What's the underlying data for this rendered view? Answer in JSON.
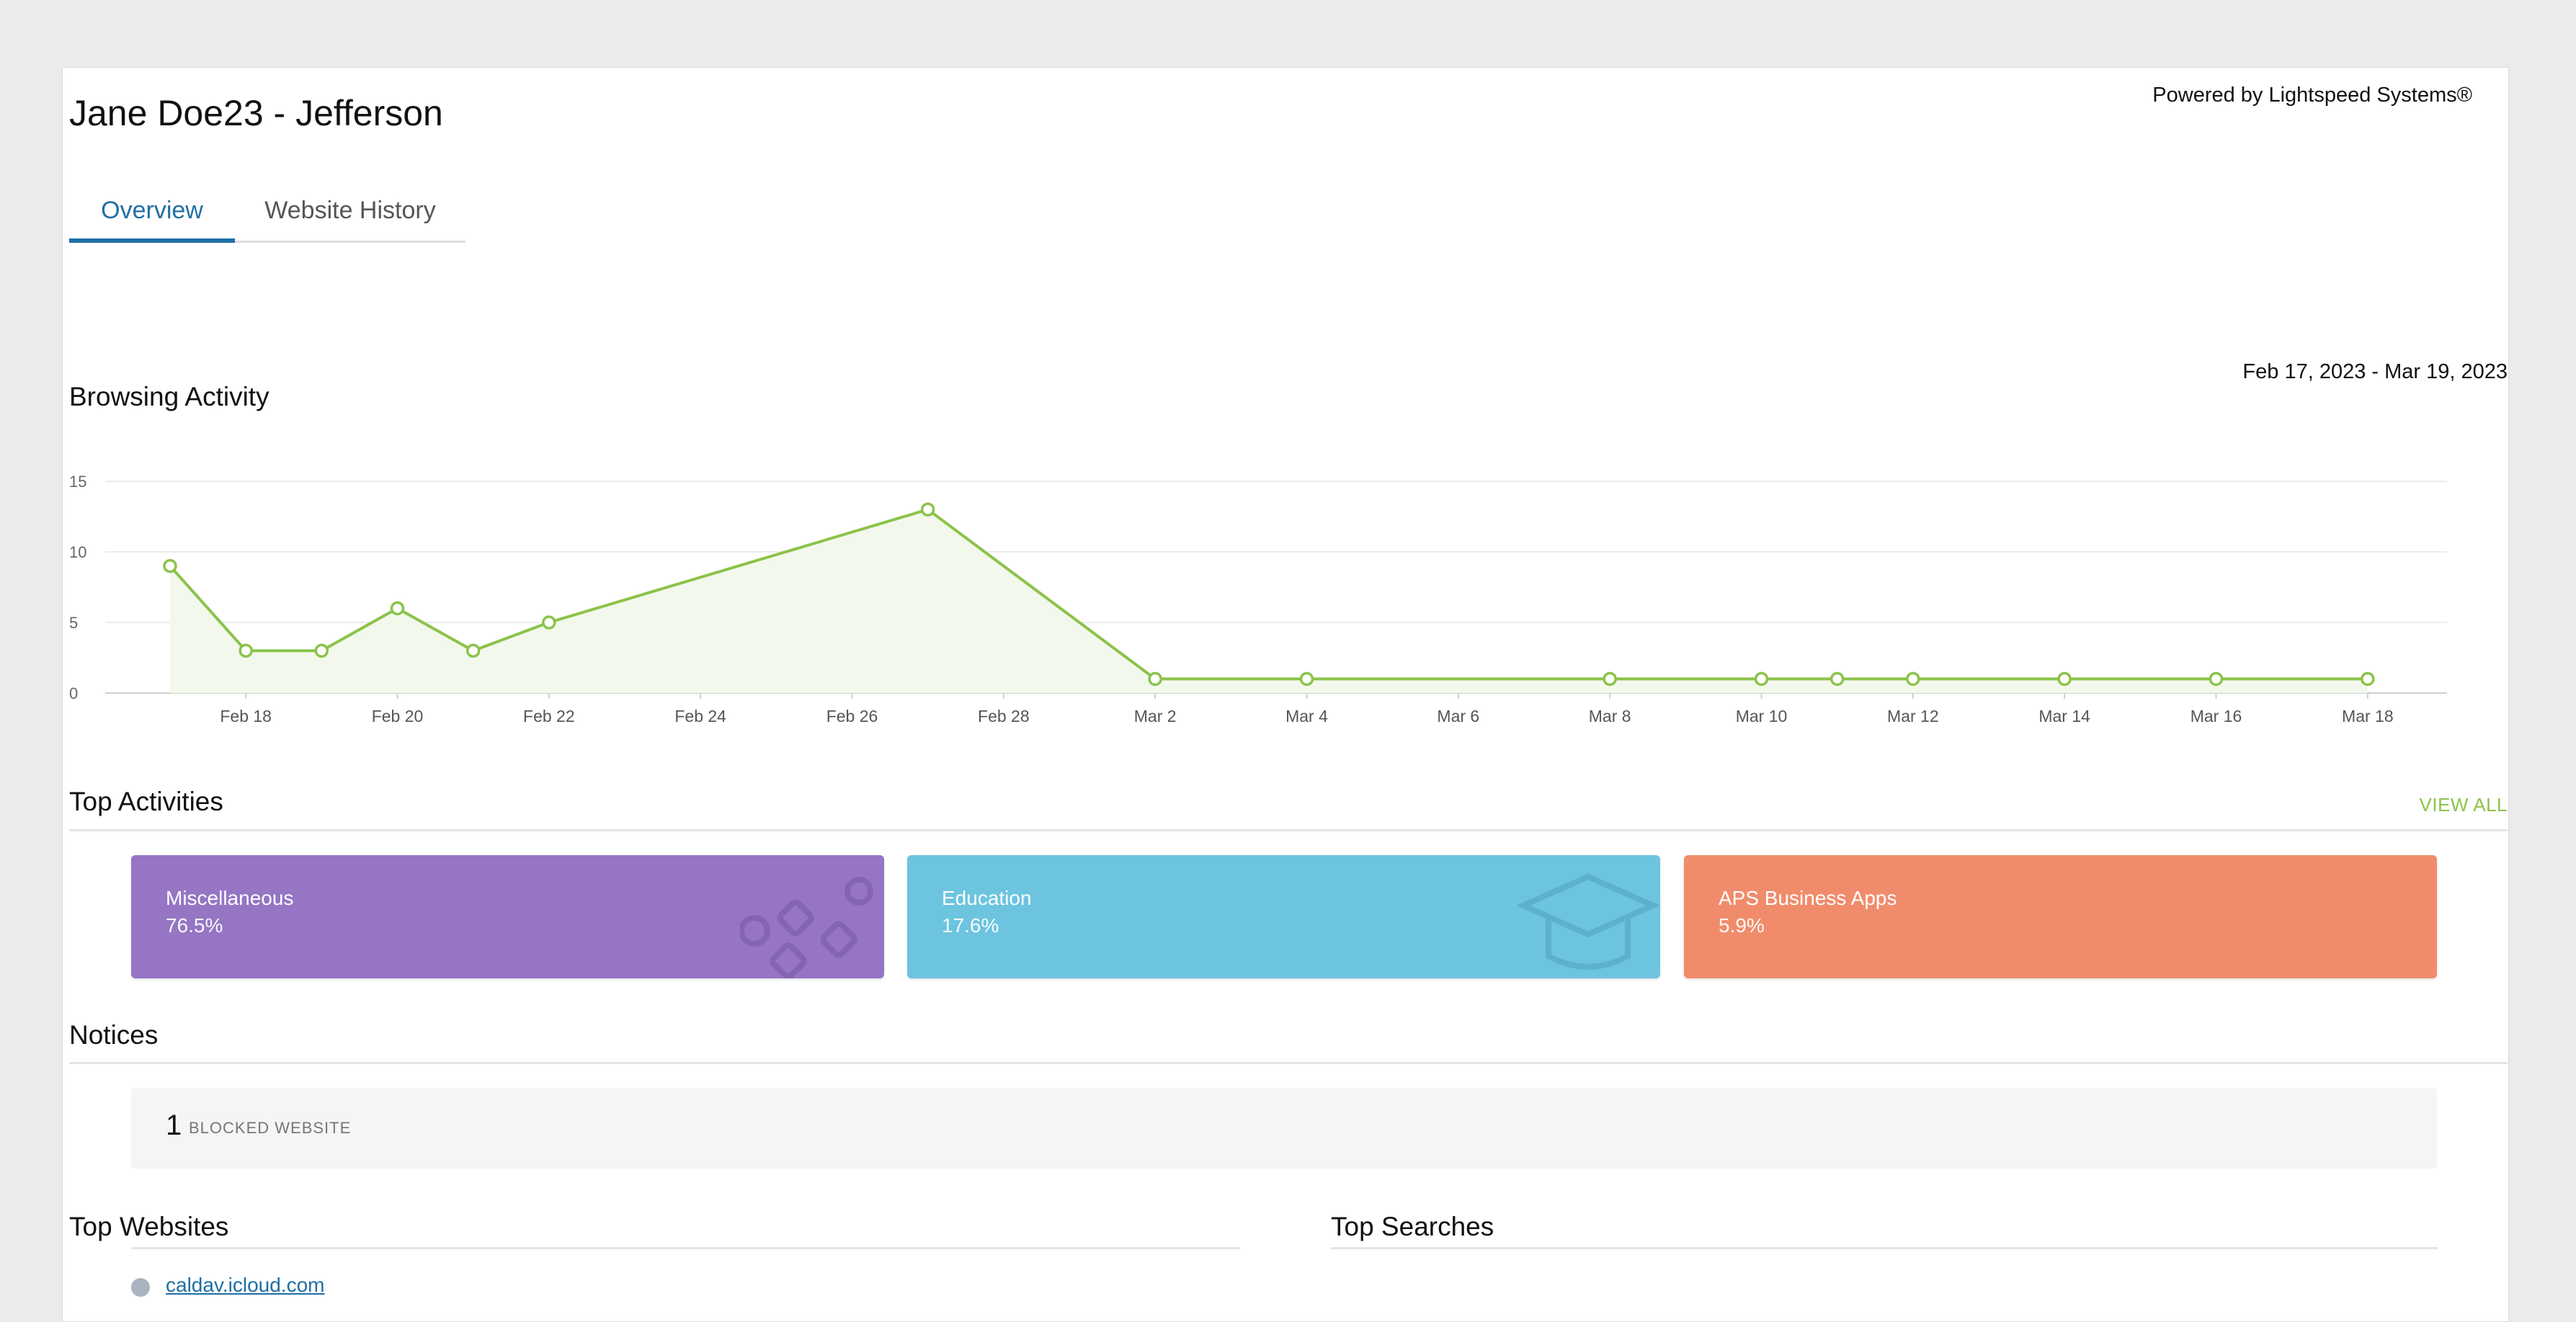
{
  "powered_by": "Powered by Lightspeed Systems®",
  "page_title": "Jane Doe23 - Jefferson",
  "tabs": [
    {
      "label": "Overview",
      "active": true
    },
    {
      "label": "Website History",
      "active": false
    }
  ],
  "browsing": {
    "heading": "Browsing Activity",
    "date_range": "Feb 17, 2023 - Mar 19, 2023"
  },
  "chart_data": {
    "type": "area",
    "color": "#8bc34a",
    "fill": "#f3f8ec",
    "grid": true,
    "ylim": [
      0,
      15
    ],
    "y_ticks": [
      0,
      5,
      10,
      15
    ],
    "x_tick_labels": [
      "Feb 18",
      "Feb 20",
      "Feb 22",
      "Feb 24",
      "Feb 26",
      "Feb 28",
      "Mar 2",
      "Mar 4",
      "Mar 6",
      "Mar 8",
      "Mar 10",
      "Mar 12",
      "Mar 14",
      "Mar 16",
      "Mar 18"
    ],
    "x_dates": [
      "Feb 17",
      "Feb 18",
      "Feb 19",
      "Feb 20",
      "Feb 21",
      "Feb 22",
      "Feb 27",
      "Mar 2",
      "Mar 4",
      "Mar 8",
      "Mar 10",
      "Mar 11",
      "Mar 12",
      "Mar 14",
      "Mar 16",
      "Mar 18"
    ],
    "points": [
      {
        "x": "Feb 17",
        "y": 9
      },
      {
        "x": "Feb 18",
        "y": 3
      },
      {
        "x": "Feb 19",
        "y": 3
      },
      {
        "x": "Feb 20",
        "y": 6
      },
      {
        "x": "Feb 21",
        "y": 3
      },
      {
        "x": "Feb 22",
        "y": 5
      },
      {
        "x": "Feb 27",
        "y": 13
      },
      {
        "x": "Mar 2",
        "y": 1
      },
      {
        "x": "Mar 4",
        "y": 1
      },
      {
        "x": "Mar 8",
        "y": 1
      },
      {
        "x": "Mar 10",
        "y": 1
      },
      {
        "x": "Mar 11",
        "y": 1
      },
      {
        "x": "Mar 12",
        "y": 1
      },
      {
        "x": "Mar 14",
        "y": 1
      },
      {
        "x": "Mar 16",
        "y": 1
      },
      {
        "x": "Mar 18",
        "y": 1
      }
    ]
  },
  "top_activities": {
    "heading": "Top Activities",
    "view_all": "VIEW ALL",
    "tiles": [
      {
        "name": "Miscellaneous",
        "percent": "76.5%",
        "color": "#9575c4",
        "icon": "shapes-icon"
      },
      {
        "name": "Education",
        "percent": "17.6%",
        "color": "#6cc4df",
        "icon": "graduation-cap-icon"
      },
      {
        "name": "APS Business Apps",
        "percent": "5.9%",
        "color": "#f08c6c",
        "icon": "none"
      }
    ]
  },
  "notices": {
    "heading": "Notices",
    "count": "1",
    "label": "BLOCKED WEBSITE"
  },
  "top_websites": {
    "heading": "Top Websites",
    "first_item": "caldav.icloud.com"
  },
  "top_searches": {
    "heading": "Top Searches"
  }
}
